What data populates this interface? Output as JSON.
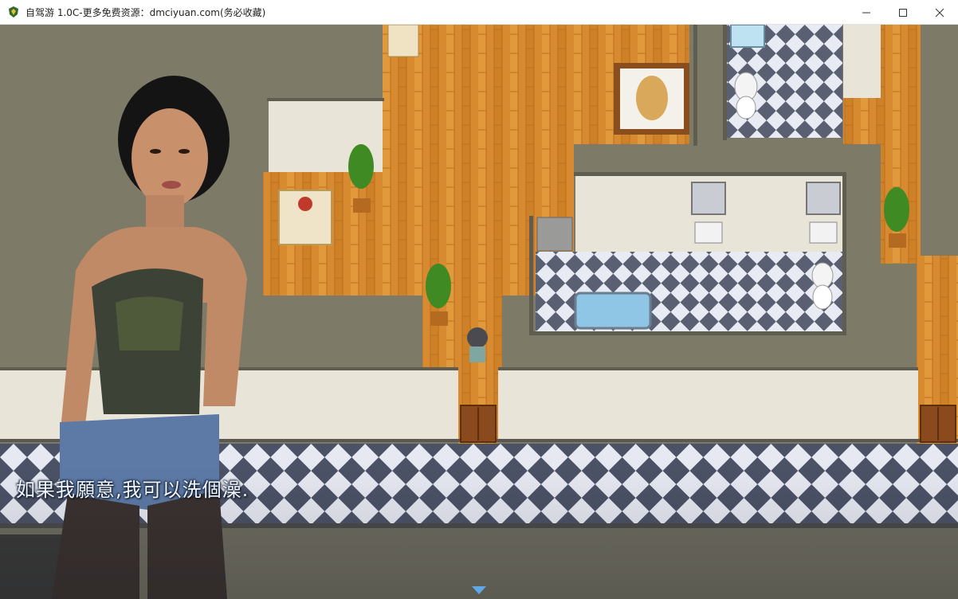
{
  "window": {
    "title": "自驾游 1.0C-更多免费资源：dmciyuan.com(务必收藏)",
    "controls": {
      "minimize": "–",
      "maximize": "☐",
      "close": "✕"
    }
  },
  "dialogue": {
    "text": "如果我願意,我可以洗個澡."
  },
  "colors": {
    "floor_wood": "#d98a2e",
    "wall_gray": "#7e7b6a",
    "wall_top": "#e8e4da",
    "tile_dark": "#4c5266",
    "tile_light": "#e6e9f2",
    "text": "#f2f6ff",
    "cursor": "#5fa8e8"
  },
  "icons": {
    "app": "shield-leaf-icon",
    "pause_cursor": "down-arrow-icon"
  }
}
